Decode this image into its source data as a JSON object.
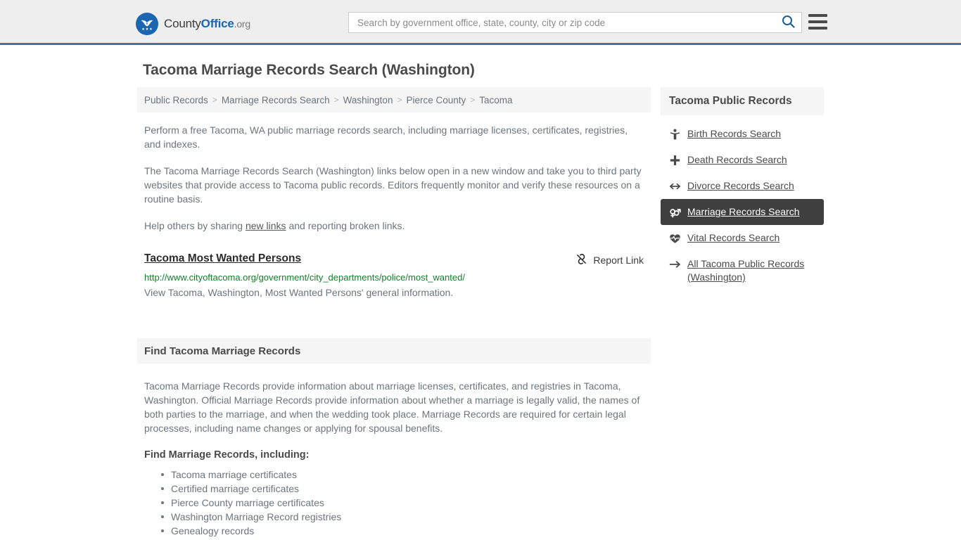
{
  "header": {
    "brand": {
      "name_part1": "County",
      "name_part2": "Office",
      "name_part3": ".org",
      "logo_icon": "eagle-stars-shield-icon"
    },
    "search": {
      "placeholder": "Search by government office, state, county, city or zip code",
      "value": "",
      "search_icon": "search-icon"
    },
    "menu_icon": "hamburger-menu-icon",
    "accent_color": "#3a75ab"
  },
  "page": {
    "title": "Tacoma Marriage Records Search (Washington)"
  },
  "breadcrumb": {
    "items": [
      {
        "label": "Public Records"
      },
      {
        "label": "Marriage Records Search"
      },
      {
        "label": "Washington"
      },
      {
        "label": "Pierce County"
      },
      {
        "label": "Tacoma"
      }
    ],
    "separator": ">"
  },
  "intro": {
    "paragraph1": "Perform a free Tacoma, WA public marriage records search, including marriage licenses, certificates, registries, and indexes.",
    "paragraph2": "The Tacoma Marriage Records Search (Washington) links below open in a new window and take you to third party websites that provide access to Tacoma public records. Editors frequently monitor and verify these resources on a routine basis.",
    "paragraph3_before": "Help others by sharing ",
    "paragraph3_link": "new links",
    "paragraph3_after": " and reporting broken links."
  },
  "result": {
    "title": "Tacoma Most Wanted Persons",
    "url": "http://www.cityoftacoma.org/government/city_departments/police/most_wanted/",
    "description": "View Tacoma, Washington, Most Wanted Persons' general information.",
    "report_label": "Report Link",
    "report_icon": "broken-link-icon",
    "url_color": "#177c2e"
  },
  "section": {
    "heading": "Find Tacoma Marriage Records",
    "paragraph": "Tacoma Marriage Records provide information about marriage licenses, certificates, and registries in Tacoma, Washington. Official Marriage Records provide information about whether a marriage is legally valid, the names of both parties to the marriage, and when the wedding took place. Marriage Records are required for certain legal processes, including name changes or applying for spousal benefits.",
    "list_heading": "Find Marriage Records, including:",
    "list_items": [
      "Tacoma marriage certificates",
      "Certified marriage certificates",
      "Pierce County marriage certificates",
      "Washington Marriage Record registries",
      "Genealogy records"
    ]
  },
  "sidebar": {
    "heading": "Tacoma Public Records",
    "active_background": "#3f3f3f",
    "items": [
      {
        "label": "Birth Records Search",
        "icon": "baby-person-icon",
        "active": false
      },
      {
        "label": "Death Records Search",
        "icon": "cross-plus-icon",
        "active": false
      },
      {
        "label": "Divorce Records Search",
        "icon": "left-right-arrow-icon",
        "active": false
      },
      {
        "label": "Marriage Records Search",
        "icon": "male-female-symbols-icon",
        "active": true
      },
      {
        "label": "Vital Records Search",
        "icon": "heart-pulse-icon",
        "active": false
      },
      {
        "label": "All Tacoma Public Records (Washington)",
        "icon": "arrow-right-icon",
        "active": false
      }
    ]
  }
}
